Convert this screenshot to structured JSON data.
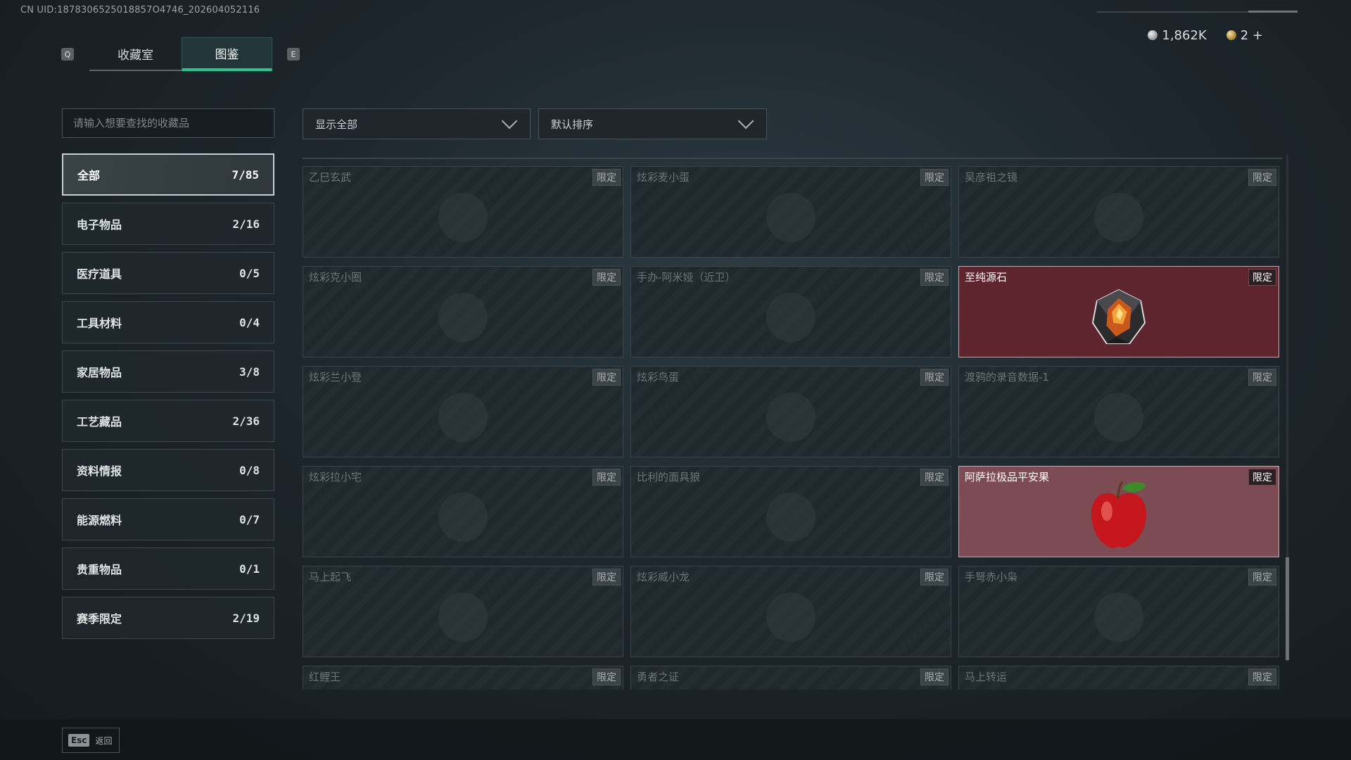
{
  "header": {
    "uid_text": "CN UID:1878306525018857O4746_202604052116",
    "key_left": "Q",
    "key_right": "E",
    "tabs": [
      {
        "label": "收藏室",
        "active": false
      },
      {
        "label": "图鉴",
        "active": true
      }
    ],
    "currency": [
      {
        "icon": "silver-coin-icon",
        "value": "1,862K"
      },
      {
        "icon": "gold-coin-icon",
        "value": "2"
      }
    ],
    "currency_plus": "+"
  },
  "search": {
    "placeholder": "请输入想要查找的收藏品",
    "value": ""
  },
  "filters": {
    "display": {
      "selected": "显示全部"
    },
    "sort": {
      "selected": "默认排序"
    }
  },
  "categories": [
    {
      "label": "全部",
      "count": "7/85",
      "active": true
    },
    {
      "label": "电子物品",
      "count": "2/16"
    },
    {
      "label": "医疗道具",
      "count": "0/5"
    },
    {
      "label": "工具材料",
      "count": "0/4"
    },
    {
      "label": "家居物品",
      "count": "3/8"
    },
    {
      "label": "工艺藏品",
      "count": "2/36"
    },
    {
      "label": "资料情报",
      "count": "0/8"
    },
    {
      "label": "能源燃料",
      "count": "0/7"
    },
    {
      "label": "贵重物品",
      "count": "0/1"
    },
    {
      "label": "赛季限定",
      "count": "2/19"
    }
  ],
  "items": [
    {
      "name": "乙巳玄武",
      "badge": "限定",
      "owned": false
    },
    {
      "name": "炫彩麦小蛋",
      "badge": "限定",
      "owned": false
    },
    {
      "name": "吴彦祖之镜",
      "badge": "限定",
      "owned": false
    },
    {
      "name": "炫彩克小圈",
      "badge": "限定",
      "owned": false
    },
    {
      "name": "手办-阿米娅（近卫）",
      "badge": "限定",
      "owned": false
    },
    {
      "name": "至纯源石",
      "badge": "限定",
      "owned": true,
      "icon": "originium-gem-icon"
    },
    {
      "name": "炫彩兰小登",
      "badge": "限定",
      "owned": false
    },
    {
      "name": "炫彩鸟蛋",
      "badge": "限定",
      "owned": false
    },
    {
      "name": "渡鸦的录音数据-1",
      "badge": "限定",
      "owned": false
    },
    {
      "name": "炫彩拉小宅",
      "badge": "限定",
      "owned": false
    },
    {
      "name": "比利的面具狼",
      "badge": "限定",
      "owned": false
    },
    {
      "name": "阿萨拉极品平安果",
      "badge": "限定",
      "owned": true,
      "icon": "red-apple-icon"
    },
    {
      "name": "马上起飞",
      "badge": "限定",
      "owned": false
    },
    {
      "name": "炫彩威小龙",
      "badge": "限定",
      "owned": false
    },
    {
      "name": "手弩赤小枭",
      "badge": "限定",
      "owned": false
    },
    {
      "name": "红鲤王",
      "badge": "限定",
      "owned": false
    },
    {
      "name": "勇者之证",
      "badge": "限定",
      "owned": false
    },
    {
      "name": "马上转运",
      "badge": "限定",
      "owned": false
    }
  ],
  "footer": {
    "esc_key": "Esc",
    "esc_label": "返回"
  },
  "colors": {
    "accent": "#2ec48e",
    "owned_card": "#5f252e",
    "background": "#1d262c"
  }
}
